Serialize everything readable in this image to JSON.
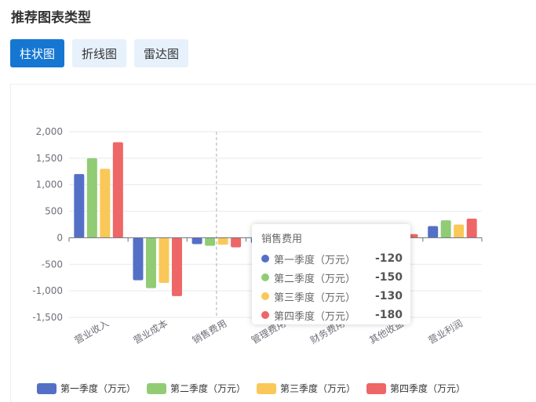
{
  "page": {
    "title": "推荐图表类型"
  },
  "tabs": [
    {
      "label": "柱状图",
      "active": true
    },
    {
      "label": "折线图",
      "active": false
    },
    {
      "label": "雷达图",
      "active": false
    }
  ],
  "chart_data": {
    "type": "bar",
    "categories": [
      "营业收入",
      "营业成本",
      "销售费用",
      "管理费用",
      "财务费用",
      "其他收益",
      "营业利润"
    ],
    "series": [
      {
        "name": "第一季度（万元）",
        "color": "#5470c6",
        "values": [
          1200,
          -800,
          -120,
          -100,
          -30,
          20,
          220
        ]
      },
      {
        "name": "第二季度（万元）",
        "color": "#91cc75",
        "values": [
          1500,
          -950,
          -150,
          -120,
          -40,
          30,
          330
        ]
      },
      {
        "name": "第三季度（万元）",
        "color": "#fac858",
        "values": [
          1300,
          -850,
          -130,
          -110,
          -35,
          50,
          250
        ]
      },
      {
        "name": "第四季度（万元）",
        "color": "#ee6666",
        "values": [
          1800,
          -1100,
          -180,
          -140,
          -50,
          70,
          360
        ]
      }
    ],
    "y_ticks": [
      "2,000",
      "1,500",
      "1,000",
      "500",
      "0",
      "-500",
      "-1,000",
      "-1,500"
    ],
    "ylim": [
      -1500,
      2000
    ],
    "grid": true,
    "legend_position": "bottom"
  },
  "tooltip": {
    "title": "销售费用",
    "rows": [
      {
        "name": "第一季度（万元）",
        "value": "-120",
        "color": "#5470c6"
      },
      {
        "name": "第二季度（万元）",
        "value": "-150",
        "color": "#91cc75"
      },
      {
        "name": "第三季度（万元）",
        "value": "-130",
        "color": "#fac858"
      },
      {
        "name": "第四季度（万元）",
        "value": "-180",
        "color": "#ee6666"
      }
    ]
  }
}
